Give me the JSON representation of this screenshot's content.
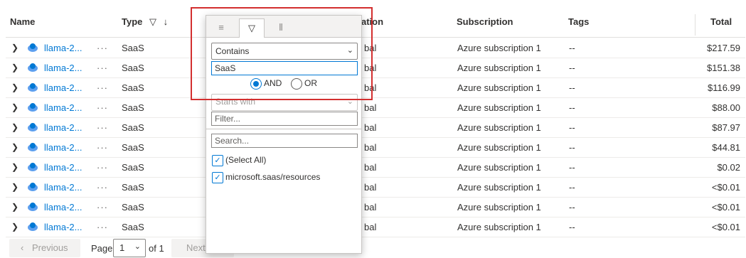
{
  "columns": {
    "name": "Name",
    "type": "Type",
    "location_partial": "ation",
    "subscription": "Subscription",
    "tags": "Tags",
    "total": "Total"
  },
  "rows": [
    {
      "name": "llama-2...",
      "more": "···",
      "type": "SaaS",
      "loc": "bal",
      "subscription": "Azure subscription 1",
      "tags": "--",
      "total": "$217.59"
    },
    {
      "name": "llama-2...",
      "more": "···",
      "type": "SaaS",
      "loc": "bal",
      "subscription": "Azure subscription 1",
      "tags": "--",
      "total": "$151.38"
    },
    {
      "name": "llama-2...",
      "more": "···",
      "type": "SaaS",
      "loc": "bal",
      "subscription": "Azure subscription 1",
      "tags": "--",
      "total": "$116.99"
    },
    {
      "name": "llama-2...",
      "more": "···",
      "type": "SaaS",
      "loc": "bal",
      "subscription": "Azure subscription 1",
      "tags": "--",
      "total": "$88.00"
    },
    {
      "name": "llama-2...",
      "more": "···",
      "type": "SaaS",
      "loc": "bal",
      "subscription": "Azure subscription 1",
      "tags": "--",
      "total": "$87.97"
    },
    {
      "name": "llama-2...",
      "more": "···",
      "type": "SaaS",
      "loc": "bal",
      "subscription": "Azure subscription 1",
      "tags": "--",
      "total": "$44.81"
    },
    {
      "name": "llama-2...",
      "more": "···",
      "type": "SaaS",
      "loc": "bal",
      "subscription": "Azure subscription 1",
      "tags": "--",
      "total": "$0.02"
    },
    {
      "name": "llama-2...",
      "more": "···",
      "type": "SaaS",
      "loc": "bal",
      "subscription": "Azure subscription 1",
      "tags": "--",
      "total": "<$0.01"
    },
    {
      "name": "llama-2...",
      "more": "···",
      "type": "SaaS",
      "loc": "bal",
      "subscription": "Azure subscription 1",
      "tags": "--",
      "total": "<$0.01"
    },
    {
      "name": "llama-2...",
      "more": "···",
      "type": "SaaS",
      "loc": "bal",
      "subscription": "Azure subscription 1",
      "tags": "--",
      "total": "<$0.01"
    }
  ],
  "pager": {
    "previous": "Previous",
    "page_label": "Page",
    "page_value": "1",
    "of_label": "of 1",
    "next": "Next"
  },
  "filter_popup": {
    "condition1": "Contains",
    "value1": "SaaS",
    "and_label": "AND",
    "or_label": "OR",
    "condition2": "Starts with",
    "filter_placeholder": "Filter...",
    "search_placeholder": "Search...",
    "select_all": "(Select All)",
    "option1": "microsoft.saas/resources"
  },
  "colors": {
    "link": "#0078d4",
    "highlight": "#d32f2f"
  }
}
